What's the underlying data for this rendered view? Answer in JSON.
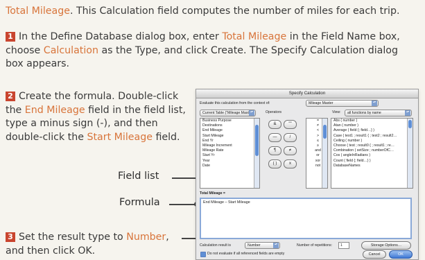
{
  "intro": {
    "term": "Total Mileage",
    "rest": ". This Calculation field computes the number of miles for each trip."
  },
  "step1": {
    "number": "1",
    "t1": "In the Define Database dialog box, enter ",
    "a1": "Total Mileage",
    "t2": " in the Field Name box, choose ",
    "a2": "Calculation",
    "t3": " as the Type, and click Create. The Specify Calculation dialog box appears."
  },
  "step2": {
    "number": "2",
    "t1": "Create the formula. Double-click the ",
    "a1": "End Mileage",
    "t2": " field in the field list, type a minus sign (-), and then double-click the ",
    "a2": "Start Mileage",
    "t3": " field."
  },
  "step3": {
    "number": "3",
    "t1": "Set the result type to ",
    "a1": "Number",
    "t2": ", and then click OK."
  },
  "callouts": {
    "field_list": "Field list",
    "formula": "Formula"
  },
  "dialog": {
    "title": "Specify Calculation",
    "context_label": "Evaluate this calculation from the context of:",
    "context_value": "Mileage Master",
    "table_popup": "Current Table (\"Mileage Mast…",
    "operators_label": "Operators",
    "view_label": "View:",
    "view_value": "all functions by name",
    "fields": [
      "Business Purpose",
      "Destinations",
      "End Mileage",
      "Start Mileage",
      "End Yr",
      "Mileage Increment",
      "Mileage Rate",
      "Start Yr",
      "Year",
      "Date"
    ],
    "op_buttons": [
      "&",
      "\"\"",
      "—",
      "/",
      "¶",
      "≠",
      "( )",
      "x"
    ],
    "op_list": [
      "=",
      "≠",
      "<",
      ">",
      "≤",
      "≥",
      "and",
      "or",
      "xor",
      "not"
    ],
    "functions": [
      "Abs ( number )",
      "Atan ( number )",
      "Average ( field {; field…} )",
      "Case ( test1 ; result1 { ; test2 ; result2…",
      "Ceiling ( number )",
      "Choose ( test ; result0 { ; result1 ; re…",
      "Combination ( setSize ; numberOfC…",
      "Cos ( angleInRadians )",
      "Count ( field {; field…} )",
      "DatabaseNames"
    ],
    "formula_field_label": "Total Mileage =",
    "formula_text": "End Mileage – Start Mileage",
    "result_label": "Calculation result is",
    "result_value": "Number",
    "repetitions_label": "Number of repetitions:",
    "repetitions_value": "1",
    "storage_button": "Storage Options…",
    "dont_evaluate": "Do not evaluate if all referenced fields are empty",
    "cancel_button": "Cancel",
    "ok_button": "OK"
  }
}
